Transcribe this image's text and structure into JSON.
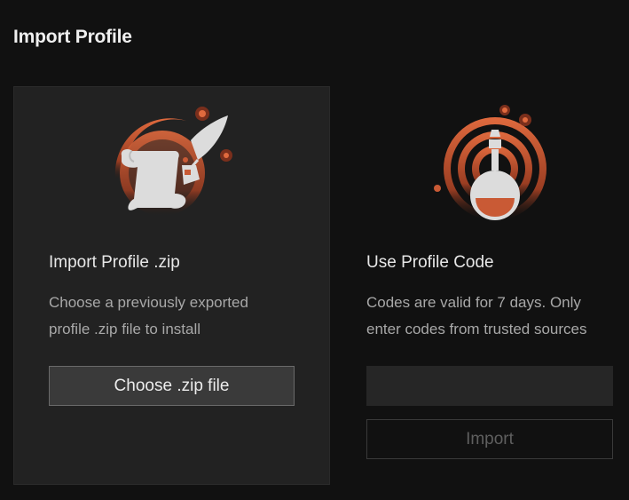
{
  "page": {
    "title": "Import Profile"
  },
  "zip_card": {
    "title": "Import Profile .zip",
    "description_line1": "Choose a previously exported",
    "description_line2": "profile .zip file to install",
    "button_label": "Choose .zip file",
    "icon": "scroll-quill-icon"
  },
  "code_card": {
    "title": "Use Profile Code",
    "description_line1": "Codes are valid for 7 days. Only",
    "description_line2": "enter codes from trusted sources",
    "input_value": "",
    "button_label": "Import",
    "icon": "potion-flask-icon"
  },
  "colors": {
    "background": "#111111",
    "panel": "#222222",
    "accent": "#d2603a",
    "accent_dark": "#7a2f1c"
  }
}
